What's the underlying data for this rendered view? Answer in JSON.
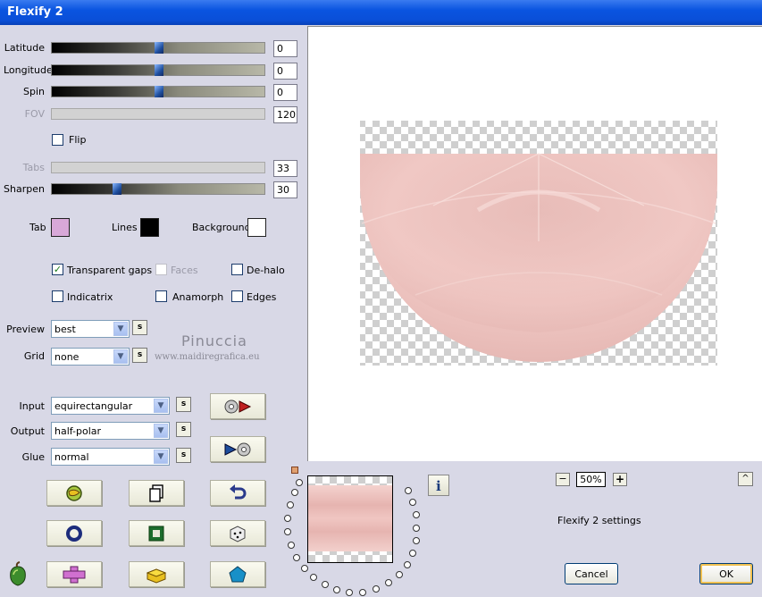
{
  "window": {
    "title": "Flexify 2"
  },
  "sliders": [
    {
      "label": "Latitude",
      "value": "0",
      "position": 0.5,
      "enabled": true
    },
    {
      "label": "Longitude",
      "value": "0",
      "position": 0.5,
      "enabled": true
    },
    {
      "label": "Spin",
      "value": "0",
      "position": 0.5,
      "enabled": true
    },
    {
      "label": "FOV",
      "value": "120",
      "position": 0.0,
      "enabled": false
    },
    {
      "label": "Tabs",
      "value": "33",
      "position": 0.0,
      "enabled": false
    },
    {
      "label": "Sharpen",
      "value": "30",
      "position": 0.3,
      "enabled": true
    }
  ],
  "flip": {
    "label": "Flip",
    "checked": false
  },
  "colors": {
    "tab": {
      "label": "Tab",
      "value": "#d8a8d8"
    },
    "lines": {
      "label": "Lines",
      "value": "#000000"
    },
    "background": {
      "label": "Background",
      "value": "#ffffff"
    }
  },
  "options": {
    "transparent_gaps": {
      "label": "Transparent gaps",
      "checked": true
    },
    "faces": {
      "label": "Faces",
      "checked": false
    },
    "de_halo": {
      "label": "De-halo",
      "checked": false
    },
    "indicatrix": {
      "label": "Indicatrix",
      "checked": false
    },
    "anamorph": {
      "label": "Anamorph",
      "checked": false
    },
    "edges": {
      "label": "Edges",
      "checked": false
    }
  },
  "preview_select": {
    "label": "Preview",
    "value": "best"
  },
  "grid_select": {
    "label": "Grid",
    "value": "none"
  },
  "input_select": {
    "label": "Input",
    "value": "equirectangular"
  },
  "output_select": {
    "label": "Output",
    "value": "half-polar"
  },
  "glue_select": {
    "label": "Glue",
    "value": "normal"
  },
  "small_button_label": "s",
  "watermark": {
    "name": "Pinuccia",
    "site": "www.maidiregrafica.eu"
  },
  "zoom": {
    "minus": "−",
    "value": "50%",
    "plus": "+"
  },
  "settings_label": "Flexify 2 settings",
  "info_label": "i",
  "scroll_up": "^",
  "buttons": {
    "cancel": "Cancel",
    "ok": "OK"
  },
  "checkmark": "✓",
  "dropdown_arrow": "▼"
}
